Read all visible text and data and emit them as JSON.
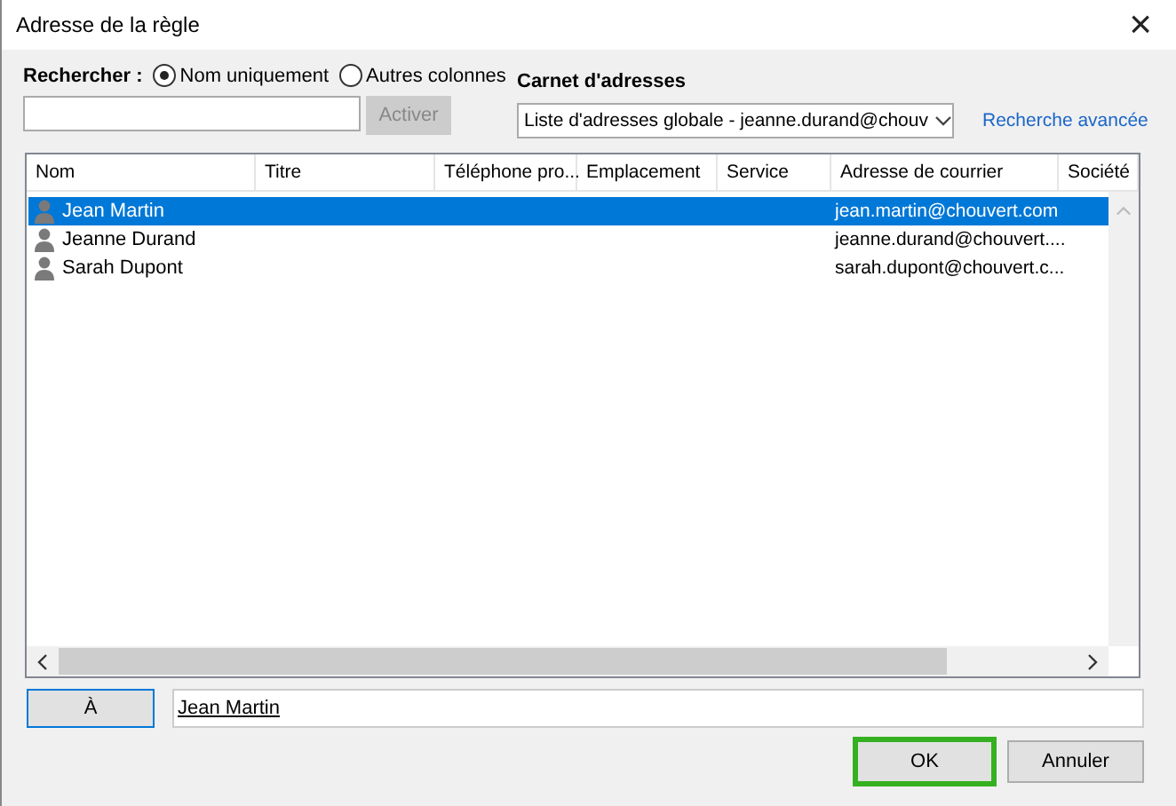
{
  "window": {
    "title": "Adresse de la règle",
    "close": "×"
  },
  "search": {
    "label": "Rechercher :",
    "options": [
      {
        "label": "Nom uniquement",
        "selected": true
      },
      {
        "label": "Autres colonnes",
        "selected": false
      }
    ],
    "go_button": {
      "label": "Activer",
      "disabled": true
    }
  },
  "address_book": {
    "label": "Carnet d'adresses",
    "value": "Liste d'adresses globale - jeanne.durand@chouv",
    "advanced_link": "Recherche avancée"
  },
  "table": {
    "columns": [
      "Nom",
      "Titre",
      "Téléphone pro...",
      "Emplacement",
      "Service",
      "Adresse de courrier",
      "Société"
    ],
    "rows": [
      {
        "name": "Jean Martin",
        "email": "jean.martin@chouvert.com",
        "selected": true
      },
      {
        "name": "Jeanne Durand",
        "email": "jeanne.durand@chouvert....",
        "selected": false
      },
      {
        "name": "Sarah Dupont",
        "email": "sarah.dupont@chouvert.c...",
        "selected": false
      }
    ]
  },
  "to": {
    "button": "À",
    "value": "Jean Martin"
  },
  "buttons": [
    {
      "label": "OK",
      "default": true
    },
    {
      "label": "Annuler",
      "default": false
    }
  ]
}
